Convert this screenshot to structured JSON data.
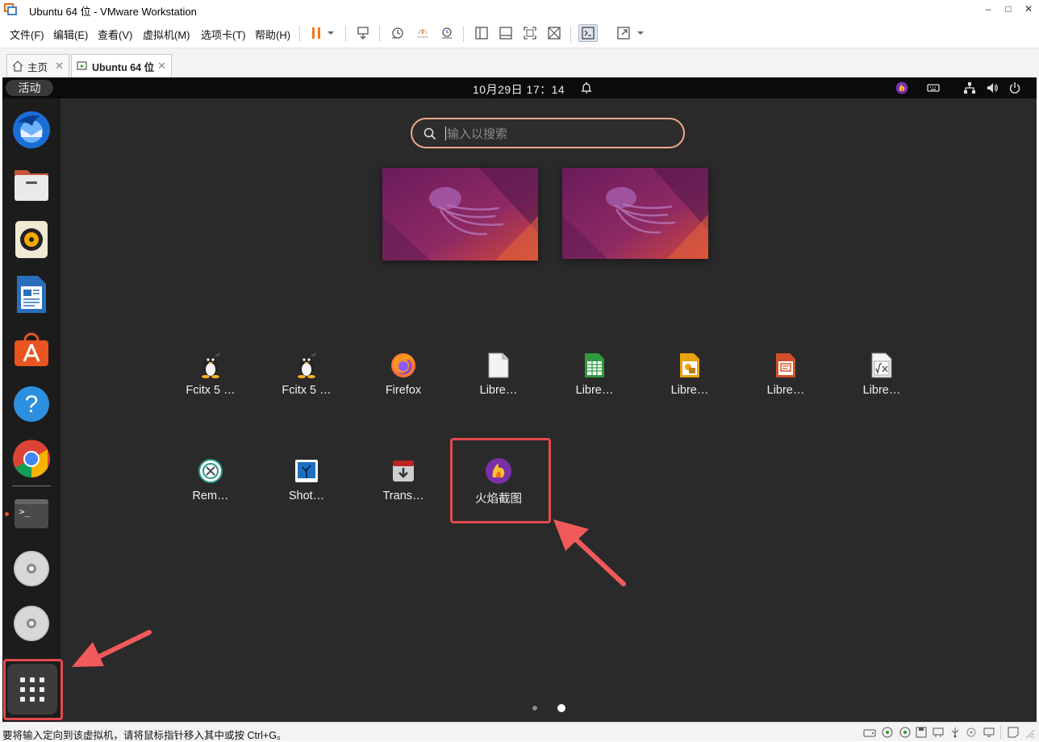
{
  "window": {
    "title": "Ubuntu 64 位 - VMware Workstation",
    "minimize": "–",
    "maximize": "□",
    "close": "✕"
  },
  "menu": {
    "items": [
      "文件(F)",
      "编辑(E)",
      "查看(V)",
      "虚拟机(M)",
      "选项卡(T)",
      "帮助(H)"
    ]
  },
  "tabs": [
    {
      "label": "主页",
      "active": false
    },
    {
      "label": "Ubuntu 64 位",
      "active": true
    }
  ],
  "guest": {
    "activities": "活动",
    "clock": "10月29日  17：14",
    "search_placeholder": "输入以搜索",
    "apps": [
      {
        "label": "Fcitx 5 …",
        "icon": "tux-icon"
      },
      {
        "label": "Fcitx 5 …",
        "icon": "tux-icon"
      },
      {
        "label": "Firefox",
        "icon": "firefox-icon"
      },
      {
        "label": "Libre…",
        "icon": "libreoffice-icon"
      },
      {
        "label": "Libre…",
        "icon": "libreoffice-calc-icon"
      },
      {
        "label": "Libre…",
        "icon": "libreoffice-draw-icon"
      },
      {
        "label": "Libre…",
        "icon": "libreoffice-impress-icon"
      },
      {
        "label": "Libre…",
        "icon": "libreoffice-math-icon"
      },
      {
        "label": "Rem…",
        "icon": "remmina-icon"
      },
      {
        "label": "Shot…",
        "icon": "shotwell-icon"
      },
      {
        "label": "Trans…",
        "icon": "transmission-icon"
      },
      {
        "label": "火焰截图",
        "icon": "flameshot-icon"
      }
    ],
    "dock": [
      "thunderbird-icon",
      "files-icon",
      "rhythmbox-icon",
      "writer-icon",
      "software-icon",
      "help-icon",
      "chrome-icon",
      "terminal-icon",
      "dvd-icon",
      "dvd-icon",
      "show-apps-icon"
    ],
    "page_count": 2,
    "active_page": 2
  },
  "statusbar": {
    "message": "要将输入定向到该虚拟机，请将鼠标指针移入其中或按 Ctrl+G。"
  },
  "colors": {
    "accent": "#e95420",
    "annotation_red": "#e5484d",
    "dock_bg": "#1c1c1c",
    "overview_bg": "#2a2a2a"
  }
}
